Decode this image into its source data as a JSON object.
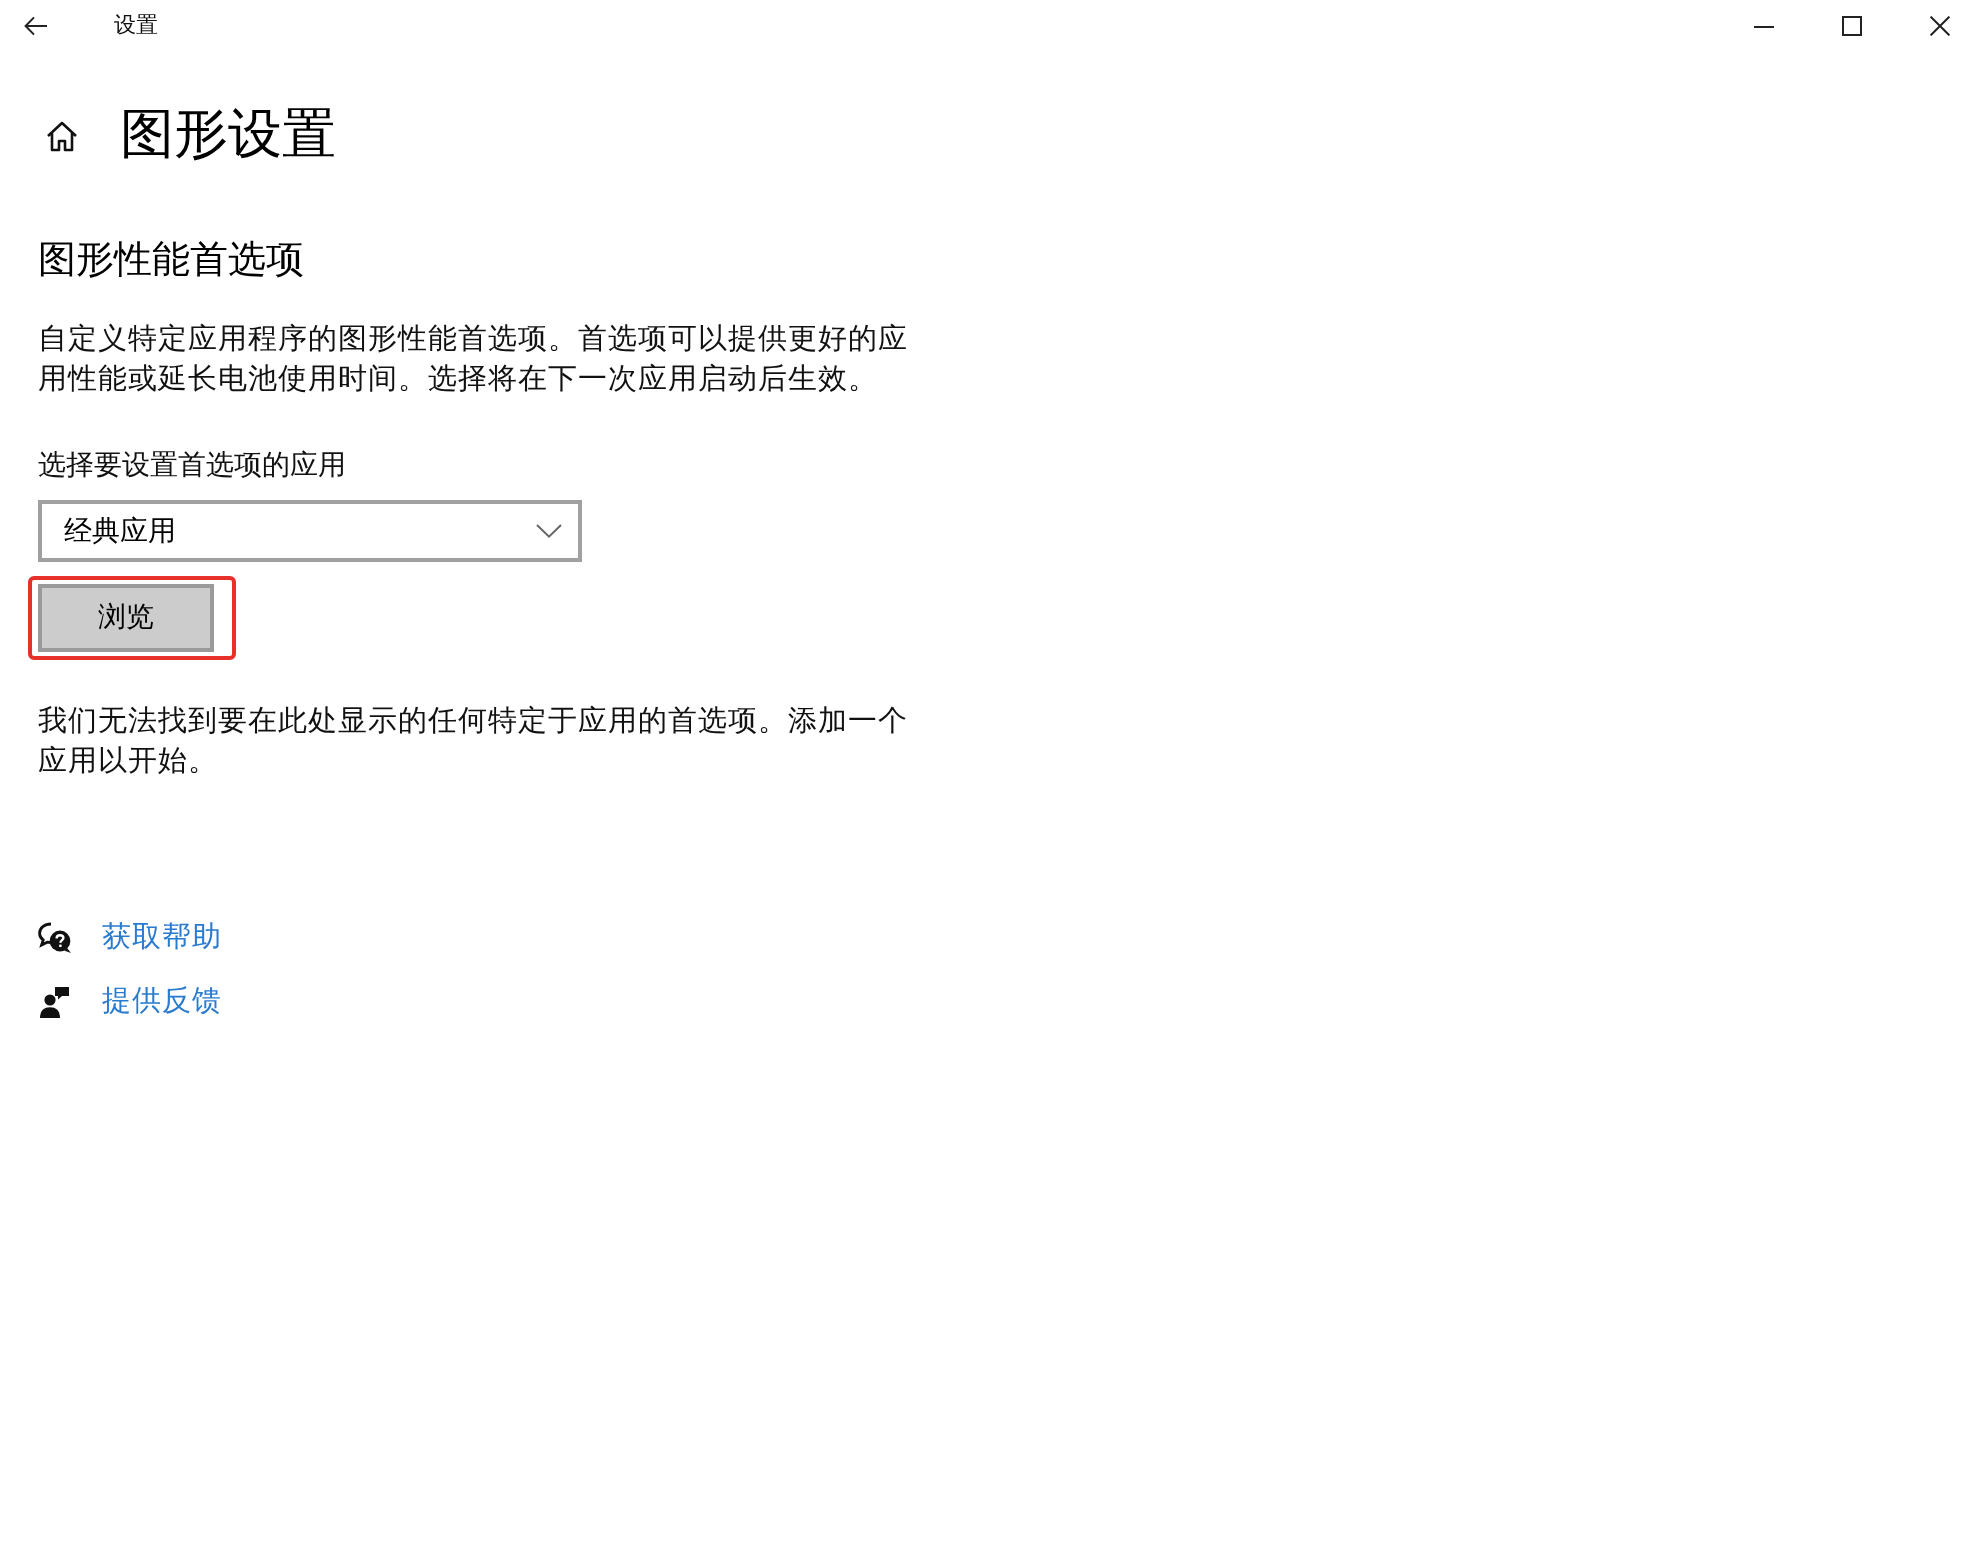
{
  "title_bar": {
    "title": "设置"
  },
  "page": {
    "title": "图形设置"
  },
  "section": {
    "heading": "图形性能首选项",
    "description": "自定义特定应用程序的图形性能首选项。首选项可以提供更好的应用性能或延长电池使用时间。选择将在下一次应用启动后生效。",
    "select_label": "选择要设置首选项的应用",
    "select": {
      "value": "经典应用"
    },
    "browse_button": {
      "label": "浏览",
      "highlighted": true
    },
    "empty_message": "我们无法找到要在此处显示的任何特定于应用的首选项。添加一个应用以开始。"
  },
  "links": [
    {
      "kind": "help",
      "label": "获取帮助"
    },
    {
      "kind": "feedback",
      "label": "提供反馈"
    }
  ]
}
